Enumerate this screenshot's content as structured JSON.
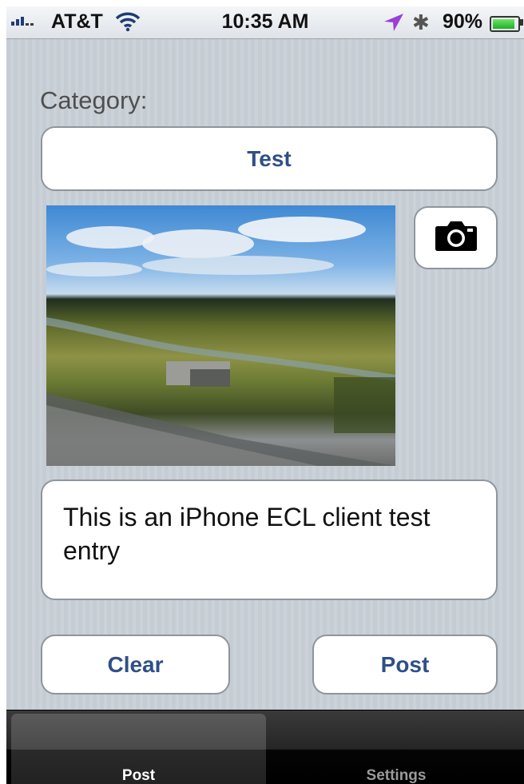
{
  "status_bar": {
    "carrier": "AT&T",
    "time": "10:35 AM",
    "battery": "90%",
    "battery_level": 0.9,
    "icons": [
      "signal-bars-icon",
      "wifi-icon",
      "location-arrow-icon",
      "bluetooth-icon",
      "battery-icon"
    ]
  },
  "form": {
    "category_label": "Category:",
    "category_value": "Test",
    "camera_icon": "camera-icon",
    "entry_text": "This is an iPhone ECL client test entry",
    "clear_label": "Clear",
    "post_label": "Post"
  },
  "tabs": [
    {
      "label": "Post",
      "selected": true
    },
    {
      "label": "Settings",
      "selected": false
    }
  ],
  "colors": {
    "button_text": "#2f4f88",
    "background": "#c5ccd4",
    "battery_green": "#1fae22",
    "location_arrow": "#9b3fd6"
  }
}
